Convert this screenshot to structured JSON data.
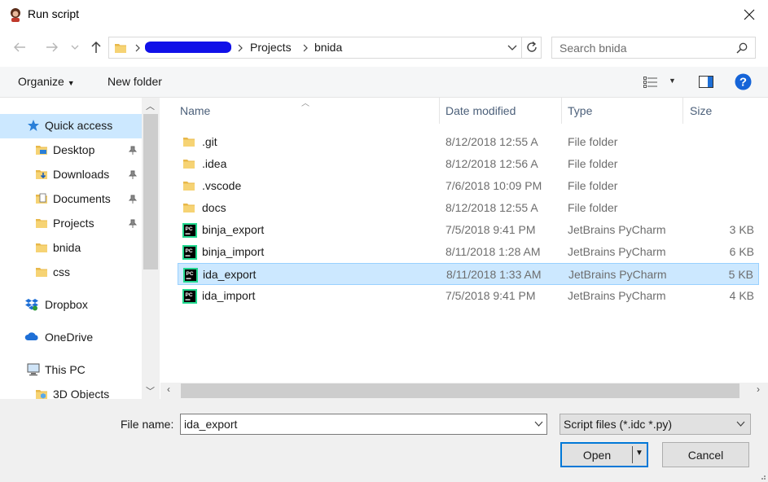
{
  "window": {
    "title": "Run script",
    "close_icon": "close-icon"
  },
  "address": {
    "crumbs": [
      "Projects",
      "bnida"
    ],
    "redacted": true,
    "search_placeholder": "Search bnida"
  },
  "toolbar": {
    "organize_label": "Organize",
    "new_folder_label": "New folder"
  },
  "nav": {
    "items": [
      {
        "label": "Quick access",
        "icon": "star-icon",
        "pinned": false,
        "selected": true
      },
      {
        "label": "Desktop",
        "icon": "desktop-folder-icon",
        "pinned": true
      },
      {
        "label": "Downloads",
        "icon": "downloads-folder-icon",
        "pinned": true
      },
      {
        "label": "Documents",
        "icon": "documents-folder-icon",
        "pinned": true
      },
      {
        "label": "Projects",
        "icon": "folder-icon",
        "pinned": true
      },
      {
        "label": "bnida",
        "icon": "folder-icon",
        "pinned": false
      },
      {
        "label": "css",
        "icon": "folder-icon",
        "pinned": false
      },
      {
        "label": "Dropbox",
        "icon": "dropbox-icon",
        "pinned": false
      },
      {
        "label": "OneDrive",
        "icon": "onedrive-icon",
        "pinned": false
      },
      {
        "label": "This PC",
        "icon": "this-pc-icon",
        "pinned": false
      },
      {
        "label": "3D Objects",
        "icon": "3d-objects-folder-icon",
        "pinned": false
      }
    ]
  },
  "files": {
    "columns": [
      "Name",
      "Date modified",
      "Type",
      "Size"
    ],
    "rows": [
      {
        "name": ".git",
        "date": "8/12/2018 12:55 A",
        "type": "File folder",
        "size": "",
        "kind": "folder"
      },
      {
        "name": ".idea",
        "date": "8/12/2018 12:56 A",
        "type": "File folder",
        "size": "",
        "kind": "folder"
      },
      {
        "name": ".vscode",
        "date": "7/6/2018 10:09 PM",
        "type": "File folder",
        "size": "",
        "kind": "folder"
      },
      {
        "name": "docs",
        "date": "8/12/2018 12:55 A",
        "type": "File folder",
        "size": "",
        "kind": "folder"
      },
      {
        "name": "binja_export",
        "date": "7/5/2018 9:41 PM",
        "type": "JetBrains PyCharm",
        "size": "3 KB",
        "kind": "pycharm"
      },
      {
        "name": "binja_import",
        "date": "8/11/2018 1:28 AM",
        "type": "JetBrains PyCharm",
        "size": "6 KB",
        "kind": "pycharm"
      },
      {
        "name": "ida_export",
        "date": "8/11/2018 1:33 AM",
        "type": "JetBrains PyCharm",
        "size": "5 KB",
        "kind": "pycharm",
        "selected": true
      },
      {
        "name": "ida_import",
        "date": "7/5/2018 9:41 PM",
        "type": "JetBrains PyCharm",
        "size": "4 KB",
        "kind": "pycharm"
      }
    ]
  },
  "footer": {
    "file_name_label": "File name:",
    "file_name_value": "ida_export",
    "filter_value": "Script files (*.idc *.py)",
    "open_label": "Open",
    "cancel_label": "Cancel"
  },
  "colors": {
    "selection": "#cce8ff",
    "accent": "#0078d7",
    "folder": "#e8b84a"
  }
}
